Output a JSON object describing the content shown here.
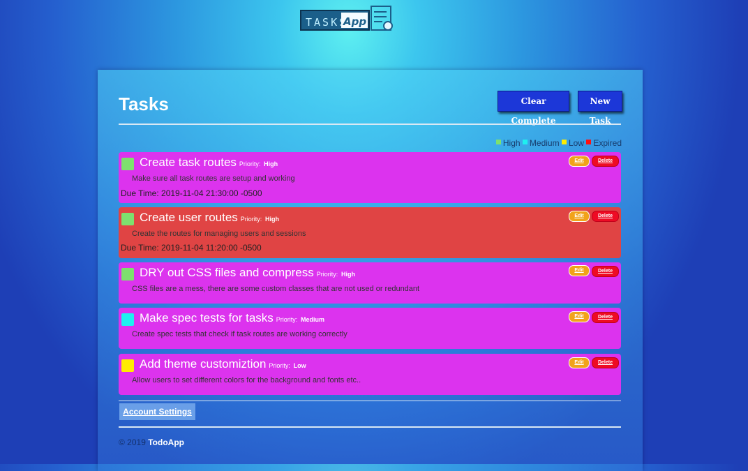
{
  "header": {
    "logo_text": "TASKS App"
  },
  "page": {
    "title": "Tasks",
    "clear_complete_label": "Clear Complete",
    "new_task_label": "New Task"
  },
  "legend": [
    {
      "label": "High",
      "color": "#7ee06e"
    },
    {
      "label": "Medium",
      "color": "#1ef0f0"
    },
    {
      "label": "Low",
      "color": "#ffec00"
    },
    {
      "label": "Expired",
      "color": "#ff1010"
    }
  ],
  "task_labels": {
    "priority": "Priority:",
    "edit": "Edit",
    "delete": "Delete"
  },
  "tasks": [
    {
      "name": "Create task routes",
      "priority": "High",
      "priority_color": "#7ee06e",
      "description": "Make sure all task routes are setup and working",
      "due": "Due Time: 2019-11-04 21:30:00 -0500",
      "background": "#dc33ee"
    },
    {
      "name": "Create user routes",
      "priority": "High",
      "priority_color": "#7ee06e",
      "description": "Create the routes for managing users and sessions",
      "due": "Due Time: 2019-11-04 11:20:00 -0500",
      "background": "#e04444"
    },
    {
      "name": "DRY out CSS files and compress",
      "priority": "High",
      "priority_color": "#7ee06e",
      "description": "CSS files are a mess, there are some custom classes that are not used or redundant",
      "due": "",
      "background": "#dc33ee"
    },
    {
      "name": "Make spec tests for tasks",
      "priority": "Medium",
      "priority_color": "#1ef0f0",
      "description": "Create spec tests that check if task routes are working correctly",
      "due": "",
      "background": "#dc33ee"
    },
    {
      "name": "Add theme customiztion",
      "priority": "Low",
      "priority_color": "#ffec00",
      "description": "Allow users to set different colors for the background and fonts etc..",
      "due": "",
      "background": "#dc33ee"
    }
  ],
  "account_settings_label": "Account Settings",
  "footer": {
    "copyright": "© 2019",
    "brand": "TodoApp"
  }
}
